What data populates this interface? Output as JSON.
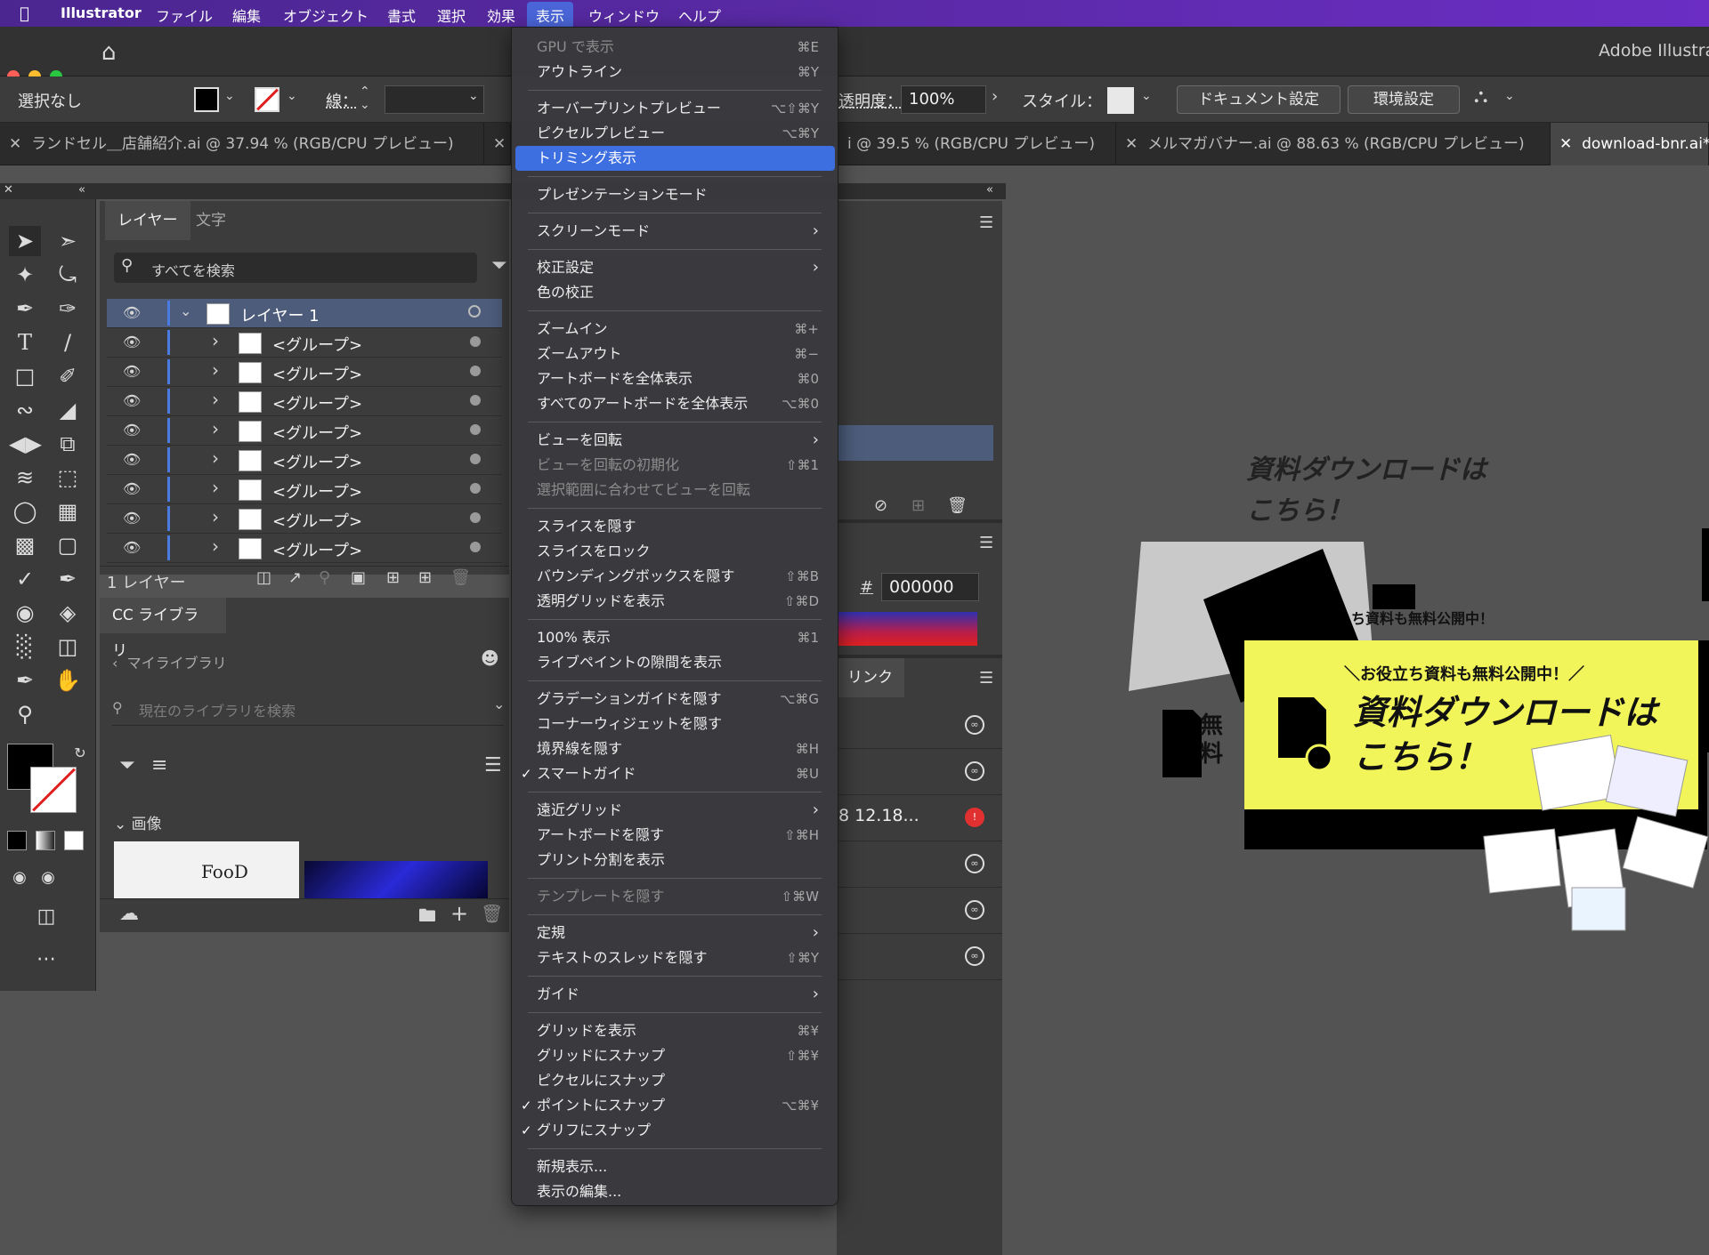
{
  "menubar": {
    "apple": "",
    "app": "Illustrator",
    "items": [
      "ファイル",
      "編集",
      "オブジェクト",
      "書式",
      "選択",
      "効果",
      "表示",
      "ウィンドウ",
      "ヘルプ"
    ]
  },
  "titlebar": {
    "title": "Adobe Illustra"
  },
  "controlbar": {
    "selection": "選択なし",
    "stroke_label": "線：",
    "opacity_label": "透明度：",
    "opacity_value": "100%",
    "style_label": "スタイル：",
    "doc_settings": "ドキュメント設定",
    "preferences": "環境設定"
  },
  "tabs": [
    {
      "label": "ランドセル＿店舗紹介.ai @ 37.94 % (RGB/CPU プレビュー)"
    },
    {
      "label": "i @ 39.5 % (RGB/CPU プレビュー)"
    },
    {
      "label": "メルマガバナー.ai @ 88.63 % (RGB/CPU プレビュー)"
    },
    {
      "label": "download-bnr.ai*"
    }
  ],
  "layers": {
    "tabs": [
      "レイヤー",
      "文字"
    ],
    "search_placeholder": "すべてを検索",
    "top": "レイヤー 1",
    "rows": [
      "<グループ>",
      "<グループ>",
      "<グループ>",
      "<グループ>",
      "<グループ>",
      "<グループ>",
      "<グループ>",
      "<グループ>"
    ],
    "count": "1 レイヤー"
  },
  "cc": {
    "title": "CC ライブラリ",
    "back": "マイライブラリ",
    "search_placeholder": "現在のライブラリを検索",
    "section": "画像",
    "thumb_text": "FooD"
  },
  "right": {
    "hash": "#",
    "hex": "000000",
    "link_tab": "リンク",
    "link_text": "8 12.18..."
  },
  "viewmenu": {
    "items": [
      {
        "label": "GPU で表示",
        "shortcut": "⌘E",
        "disabled": true
      },
      {
        "label": "アウトライン",
        "shortcut": "⌘Y"
      },
      {
        "sep": true
      },
      {
        "label": "オーバープリントプレビュー",
        "shortcut": "⌥⇧⌘Y"
      },
      {
        "label": "ピクセルプレビュー",
        "shortcut": "⌥⌘Y"
      },
      {
        "label": "トリミング表示",
        "highlighted": true
      },
      {
        "sep": true
      },
      {
        "label": "プレゼンテーションモード"
      },
      {
        "sep": true
      },
      {
        "label": "スクリーンモード",
        "submenu": true
      },
      {
        "sep": true
      },
      {
        "label": "校正設定",
        "submenu": true
      },
      {
        "label": "色の校正"
      },
      {
        "sep": true
      },
      {
        "label": "ズームイン",
        "shortcut": "⌘+"
      },
      {
        "label": "ズームアウト",
        "shortcut": "⌘−"
      },
      {
        "label": "アートボードを全体表示",
        "shortcut": "⌘0"
      },
      {
        "label": "すべてのアートボードを全体表示",
        "shortcut": "⌥⌘0"
      },
      {
        "sep": true
      },
      {
        "label": "ビューを回転",
        "submenu": true
      },
      {
        "label": "ビューを回転の初期化",
        "shortcut": "⇧⌘1",
        "disabled": true
      },
      {
        "label": "選択範囲に合わせてビューを回転",
        "disabled": true
      },
      {
        "sep": true
      },
      {
        "label": "スライスを隠す"
      },
      {
        "label": "スライスをロック"
      },
      {
        "label": "バウンディングボックスを隠す",
        "shortcut": "⇧⌘B"
      },
      {
        "label": "透明グリッドを表示",
        "shortcut": "⇧⌘D"
      },
      {
        "sep": true
      },
      {
        "label": "100% 表示",
        "shortcut": "⌘1"
      },
      {
        "label": "ライブペイントの隙間を表示"
      },
      {
        "sep": true
      },
      {
        "label": "グラデーションガイドを隠す",
        "shortcut": "⌥⌘G"
      },
      {
        "label": "コーナーウィジェットを隠す"
      },
      {
        "label": "境界線を隠す",
        "shortcut": "⌘H"
      },
      {
        "label": "スマートガイド",
        "shortcut": "⌘U",
        "checked": true
      },
      {
        "sep": true
      },
      {
        "label": "遠近グリッド",
        "submenu": true
      },
      {
        "label": "アートボードを隠す",
        "shortcut": "⇧⌘H"
      },
      {
        "label": "プリント分割を表示"
      },
      {
        "sep": true
      },
      {
        "label": "テンプレートを隠す",
        "shortcut": "⇧⌘W",
        "disabled": true
      },
      {
        "sep": true
      },
      {
        "label": "定規",
        "submenu": true
      },
      {
        "label": "テキストのスレッドを隠す",
        "shortcut": "⇧⌘Y"
      },
      {
        "sep": true
      },
      {
        "label": "ガイド",
        "submenu": true
      },
      {
        "sep": true
      },
      {
        "label": "グリッドを表示",
        "shortcut": "⌘¥"
      },
      {
        "label": "グリッドにスナップ",
        "shortcut": "⇧⌘¥"
      },
      {
        "label": "ピクセルにスナップ"
      },
      {
        "label": "ポイントにスナップ",
        "shortcut": "⌥⌘¥",
        "checked": true
      },
      {
        "label": "グリフにスナップ",
        "checked": true
      },
      {
        "sep": true
      },
      {
        "label": "新規表示..."
      },
      {
        "label": "表示の編集..."
      }
    ]
  },
  "artwork": {
    "heading_line1": "資料ダウンロードは",
    "heading_line2": "こちら！",
    "banner_small": "＼お役立ち資料も無料公開中！／",
    "banner_main1": "資料ダウンロードは",
    "banner_main2": "こちら！",
    "snippet": "ち資料も無料公開中！",
    "vertical": "無料",
    "yellow": "#f2f55a"
  }
}
